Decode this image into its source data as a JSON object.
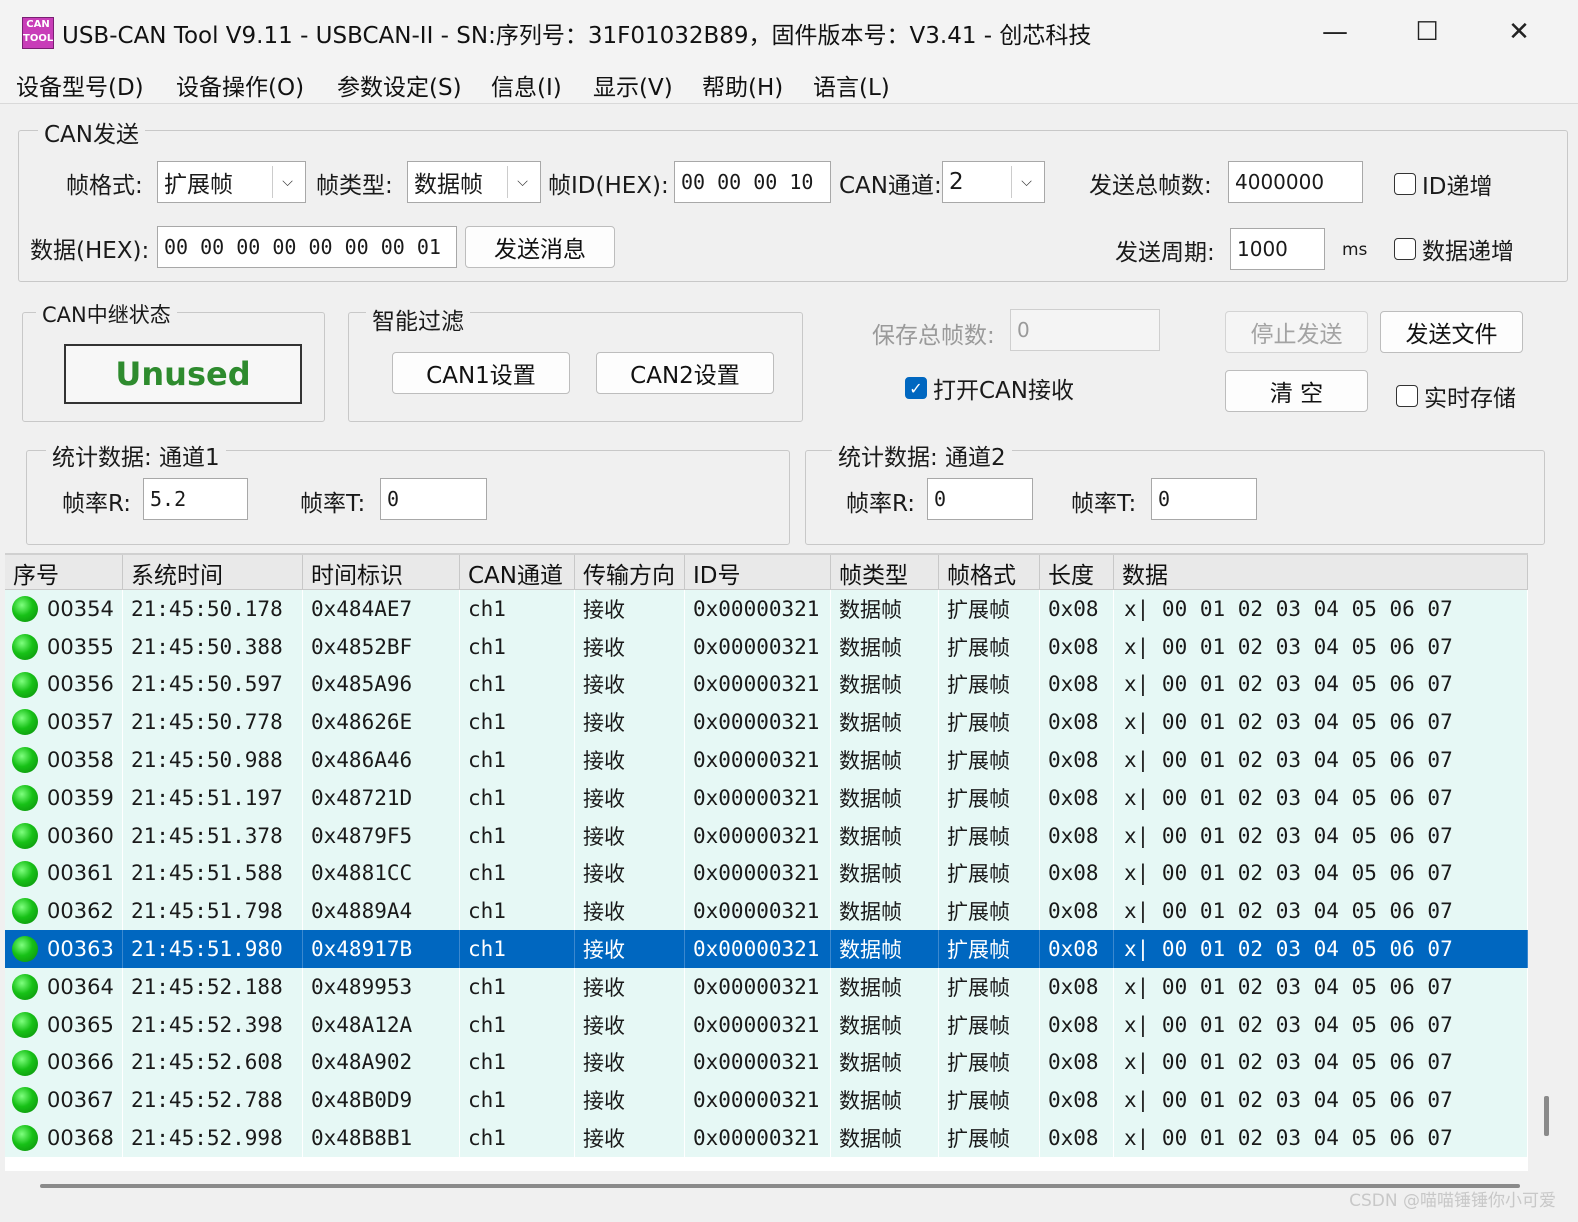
{
  "window": {
    "icon_text": "CAN TOOL",
    "title": "USB-CAN Tool V9.11 - USBCAN-II - SN:序列号：31F01032B89，固件版本号：V3.41 - 创芯科技",
    "minimize": "—",
    "maximize": "☐",
    "close": "✕"
  },
  "menu": [
    "设备型号(D)",
    "设备操作(O)",
    "参数设定(S)",
    "信息(I)",
    "显示(V)",
    "帮助(H)",
    "语言(L)"
  ],
  "can_send": {
    "title": "CAN发送",
    "frame_format_label": "帧格式:",
    "frame_format_value": "扩展帧",
    "frame_type_label": "帧类型:",
    "frame_type_value": "数据帧",
    "frame_id_label": "帧ID(HEX):",
    "frame_id_value": "00 00 00 10",
    "can_channel_label": "CAN通道:",
    "can_channel_value": "2",
    "total_frames_label": "发送总帧数:",
    "total_frames_value": "4000000",
    "id_increment_label": "ID递增",
    "id_increment_checked": false,
    "data_label": "数据(HEX):",
    "data_value": "00 00 00 00 00 00 00 01",
    "send_button": "发送消息",
    "period_label": "发送周期:",
    "period_value": "1000",
    "period_unit": "ms",
    "data_increment_label": "数据递增",
    "data_increment_checked": false
  },
  "relay": {
    "title": "CAN中继状态",
    "status": "Unused"
  },
  "filter": {
    "title": "智能过滤",
    "can1_button": "CAN1设置",
    "can2_button": "CAN2设置"
  },
  "controls": {
    "save_total_label": "保存总帧数:",
    "save_total_value": "0",
    "stop_send_button": "停止发送",
    "send_file_button": "发送文件",
    "open_receive_label": "打开CAN接收",
    "open_receive_checked": true,
    "clear_button": "清 空",
    "realtime_save_label": "实时存储",
    "realtime_save_checked": false
  },
  "stats1": {
    "title": "统计数据: 通道1",
    "rate_r_label": "帧率R:",
    "rate_r_value": "5.2",
    "rate_t_label": "帧率T:",
    "rate_t_value": "0"
  },
  "stats2": {
    "title": "统计数据: 通道2",
    "rate_r_label": "帧率R:",
    "rate_r_value": "0",
    "rate_t_label": "帧率T:",
    "rate_t_value": "0"
  },
  "table": {
    "headers": [
      "序号",
      "系统时间",
      "时间标识",
      "CAN通道",
      "传输方向",
      "ID号",
      "帧类型",
      "帧格式",
      "长度",
      "数据"
    ],
    "rows": [
      [
        "00354",
        "21:45:50.178",
        "0x484AE7",
        "ch1",
        "接收",
        "0x00000321",
        "数据帧",
        "扩展帧",
        "0x08",
        "x| 00 01 02 03 04 05 06 07"
      ],
      [
        "00355",
        "21:45:50.388",
        "0x4852BF",
        "ch1",
        "接收",
        "0x00000321",
        "数据帧",
        "扩展帧",
        "0x08",
        "x| 00 01 02 03 04 05 06 07"
      ],
      [
        "00356",
        "21:45:50.597",
        "0x485A96",
        "ch1",
        "接收",
        "0x00000321",
        "数据帧",
        "扩展帧",
        "0x08",
        "x| 00 01 02 03 04 05 06 07"
      ],
      [
        "00357",
        "21:45:50.778",
        "0x48626E",
        "ch1",
        "接收",
        "0x00000321",
        "数据帧",
        "扩展帧",
        "0x08",
        "x| 00 01 02 03 04 05 06 07"
      ],
      [
        "00358",
        "21:45:50.988",
        "0x486A46",
        "ch1",
        "接收",
        "0x00000321",
        "数据帧",
        "扩展帧",
        "0x08",
        "x| 00 01 02 03 04 05 06 07"
      ],
      [
        "00359",
        "21:45:51.197",
        "0x48721D",
        "ch1",
        "接收",
        "0x00000321",
        "数据帧",
        "扩展帧",
        "0x08",
        "x| 00 01 02 03 04 05 06 07"
      ],
      [
        "00360",
        "21:45:51.378",
        "0x4879F5",
        "ch1",
        "接收",
        "0x00000321",
        "数据帧",
        "扩展帧",
        "0x08",
        "x| 00 01 02 03 04 05 06 07"
      ],
      [
        "00361",
        "21:45:51.588",
        "0x4881CC",
        "ch1",
        "接收",
        "0x00000321",
        "数据帧",
        "扩展帧",
        "0x08",
        "x| 00 01 02 03 04 05 06 07"
      ],
      [
        "00362",
        "21:45:51.798",
        "0x4889A4",
        "ch1",
        "接收",
        "0x00000321",
        "数据帧",
        "扩展帧",
        "0x08",
        "x| 00 01 02 03 04 05 06 07"
      ],
      [
        "00363",
        "21:45:51.980",
        "0x48917B",
        "ch1",
        "接收",
        "0x00000321",
        "数据帧",
        "扩展帧",
        "0x08",
        "x| 00 01 02 03 04 05 06 07"
      ],
      [
        "00364",
        "21:45:52.188",
        "0x489953",
        "ch1",
        "接收",
        "0x00000321",
        "数据帧",
        "扩展帧",
        "0x08",
        "x| 00 01 02 03 04 05 06 07"
      ],
      [
        "00365",
        "21:45:52.398",
        "0x48A12A",
        "ch1",
        "接收",
        "0x00000321",
        "数据帧",
        "扩展帧",
        "0x08",
        "x| 00 01 02 03 04 05 06 07"
      ],
      [
        "00366",
        "21:45:52.608",
        "0x48A902",
        "ch1",
        "接收",
        "0x00000321",
        "数据帧",
        "扩展帧",
        "0x08",
        "x| 00 01 02 03 04 05 06 07"
      ],
      [
        "00367",
        "21:45:52.788",
        "0x48B0D9",
        "ch1",
        "接收",
        "0x00000321",
        "数据帧",
        "扩展帧",
        "0x08",
        "x| 00 01 02 03 04 05 06 07"
      ],
      [
        "00368",
        "21:45:52.998",
        "0x48B8B1",
        "ch1",
        "接收",
        "0x00000321",
        "数据帧",
        "扩展帧",
        "0x08",
        "x| 00 01 02 03 04 05 06 07"
      ]
    ],
    "selected_row": 9
  },
  "watermark": "CSDN @喵喵锤锤你小可爱",
  "colors": {
    "selection": "#0067c0",
    "row_bg": "#e6f8f5",
    "status_green": "#17c117",
    "unused_text": "#2e8b2e"
  }
}
